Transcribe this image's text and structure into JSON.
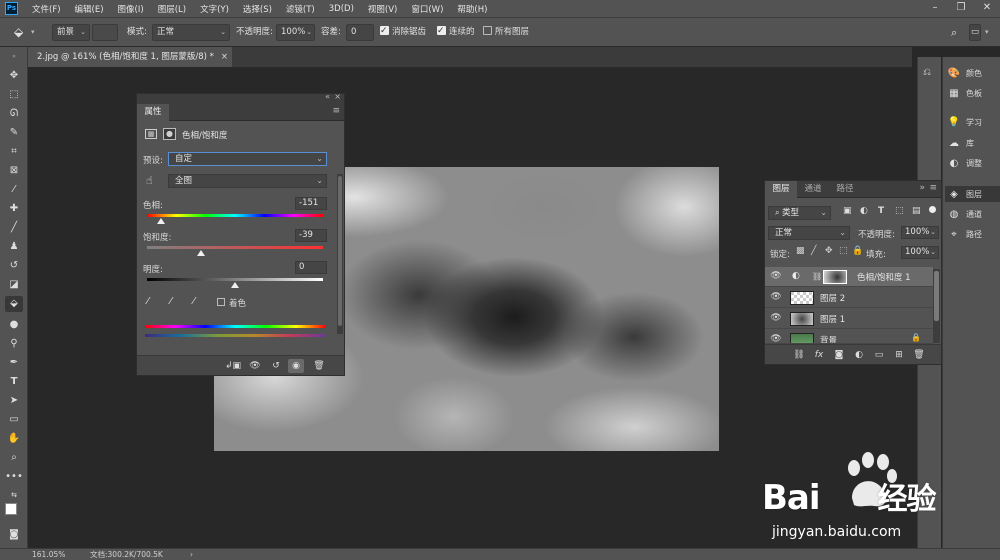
{
  "menubar": {
    "logo": "Ps",
    "items": [
      "文件(F)",
      "编辑(E)",
      "图像(I)",
      "图层(L)",
      "文字(Y)",
      "选择(S)",
      "滤镜(T)",
      "3D(D)",
      "视图(V)",
      "窗口(W)",
      "帮助(H)"
    ]
  },
  "options": {
    "foreground_select": "前景",
    "mode_label": "模式:",
    "mode_value": "正常",
    "opacity_label": "不透明度:",
    "opacity_value": "100%",
    "tolerance_label": "容差:",
    "tolerance_value": "0",
    "antialias": "消除锯齿",
    "contiguous": "连续的",
    "all_layers": "所有图层"
  },
  "document": {
    "tab_title": "2.jpg @ 161% (色相/饱和度 1, 图层蒙版/8) *",
    "close": "×"
  },
  "properties": {
    "tab": "属性",
    "title": "色相/饱和度",
    "preset_label": "预设:",
    "preset_value": "自定",
    "channel_value": "全图",
    "hue_label": "色相:",
    "hue_value": "-151",
    "saturation_label": "饱和度:",
    "saturation_value": "-39",
    "lightness_label": "明度:",
    "lightness_value": "0",
    "colorize_label": "着色",
    "hue_fraction": 0.08,
    "saturation_fraction": 0.305,
    "lightness_fraction": 0.5
  },
  "strip": {
    "items": [
      "颜色",
      "色板",
      "学习",
      "库",
      "调整",
      "图层",
      "通道",
      "路径"
    ]
  },
  "layers": {
    "tabs": [
      "图层",
      "通道",
      "路径"
    ],
    "kind_label": "类型",
    "blend_mode": "正常",
    "opacity_label": "不透明度:",
    "opacity_value": "100%",
    "lock_label": "锁定:",
    "fill_label": "填充:",
    "fill_value": "100%",
    "rows": [
      {
        "name": "色相/饱和度 1"
      },
      {
        "name": "图层 2"
      },
      {
        "name": "图层 1"
      },
      {
        "name": "背景"
      }
    ]
  },
  "status": {
    "zoom": "161.05%",
    "doc": "文档:300.2K/700.5K"
  },
  "watermark": {
    "brand": "Bai",
    "brand2": "经验",
    "url": "jingyan.baidu.com"
  },
  "colors": {
    "accent": "#31a8ff",
    "panel": "#535353",
    "canvas": "#282828"
  }
}
